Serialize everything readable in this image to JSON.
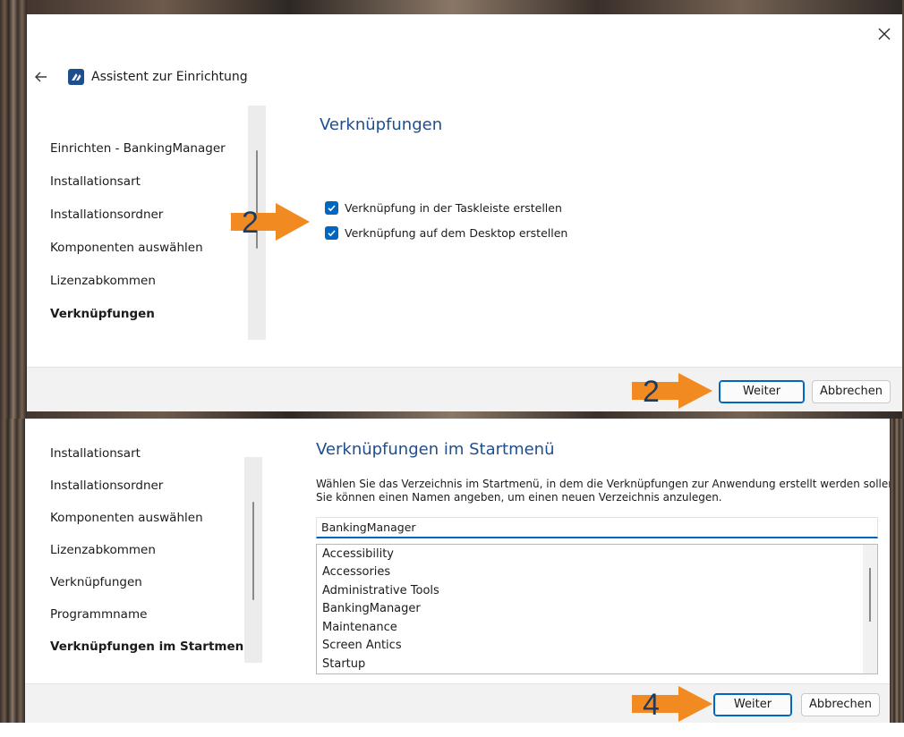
{
  "top_window": {
    "title": "Assistent zur Einrichtung",
    "nav_items": [
      {
        "label": "Einrichten - BankingManager",
        "active": false
      },
      {
        "label": "Installationsart",
        "active": false
      },
      {
        "label": "Installationsordner",
        "active": false
      },
      {
        "label": "Komponenten auswählen",
        "active": false
      },
      {
        "label": "Lizenzabkommen",
        "active": false
      },
      {
        "label": "Verknüpfungen",
        "active": true
      }
    ],
    "section_title": "Verknüpfungen",
    "checkboxes": [
      {
        "label": "Verknüpfung in der Taskleiste erstellen",
        "checked": true
      },
      {
        "label": "Verknüpfung auf dem Desktop erstellen",
        "checked": true
      }
    ],
    "annotation_checkbox_step": "2",
    "annotation_next_step": "2",
    "next_button": "Weiter",
    "cancel_button": "Abbrechen"
  },
  "bottom_window": {
    "partial_nav_item": "Installationsart",
    "nav_items": [
      {
        "label": "Installationsordner",
        "active": false
      },
      {
        "label": "Komponenten auswählen",
        "active": false
      },
      {
        "label": "Lizenzabkommen",
        "active": false
      },
      {
        "label": "Verknüpfungen",
        "active": false
      },
      {
        "label": "Programmname",
        "active": false
      },
      {
        "label": "Verknüpfungen im Startmenü",
        "active": true
      }
    ],
    "section_title": "Verknüpfungen im Startmenü",
    "description_line1": "Wählen Sie das Verzeichnis im Startmenü, in dem die Verknüpfungen zur Anwendung erstellt werden sollen.",
    "description_line2": "Sie können einen Namen angeben, um einen neuen Verzeichnis anzulegen.",
    "folder_name_value": "BankingManager",
    "folders": [
      "Accessibility",
      "Accessories",
      "Administrative Tools",
      "BankingManager",
      "Maintenance",
      "Screen Antics",
      "Startup"
    ],
    "annotation_next_step": "4",
    "next_button": "Weiter",
    "cancel_button": "Abbrechen"
  },
  "colors": {
    "accent": "#0067c0",
    "title_blue": "#1f4e8c",
    "annotation_orange": "#f28a22"
  },
  "icons": {
    "back": "arrow-left-icon",
    "app": "app-logo-icon",
    "close": "close-icon",
    "checkbox": "checkmark-icon",
    "annotation": "orange-arrow-icon"
  }
}
